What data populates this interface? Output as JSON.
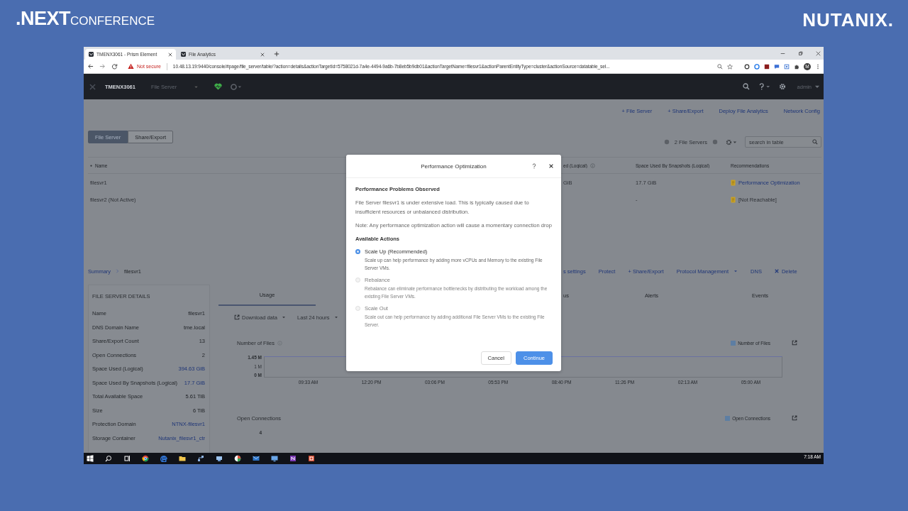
{
  "branding": {
    "event_logo": ".NEXT",
    "event_logo_suffix": "CONFERENCE",
    "sponsor_logo": "NUTANIX."
  },
  "browser": {
    "tabs": [
      {
        "title": "TMENX3061 - Prism Element",
        "selected": true
      },
      {
        "title": "File Analytics",
        "selected": false
      }
    ],
    "security_label": "Not secure",
    "url": "10.48.13.19:9440/console/#page/file_server/table/?action=details&actionTargetId=5758021d-7a4e-4494-9a6b-7b8eb5b9db01&actionTargetName=filesvr1&actionParentEntityType=cluster&actionSource=datatable_sel...",
    "profile_initial": "M"
  },
  "app_header": {
    "cluster_name": "TMENX3061",
    "section": "File Server",
    "user": "admin"
  },
  "top_actions": [
    "+ File Server",
    "+ Share/Export",
    "Deploy File Analytics",
    "Network Config"
  ],
  "view_toggle": [
    {
      "label": "File Server",
      "selected": true
    },
    {
      "label": "Share/Export",
      "selected": false
    }
  ],
  "table_summary": "2 File Servers",
  "search": {
    "placeholder": "search in table"
  },
  "table": {
    "columns": [
      "Name",
      "ed (Logical)",
      "Space Used By Snapshots (Logical)",
      "Recommendations"
    ],
    "rows": [
      {
        "name": "filesvr1",
        "column_2": "GiB",
        "snapshots": "17.7 GiB",
        "recommendation": "Performance Optimization",
        "kind": "link"
      },
      {
        "name": "filesvr2 (Not Active)",
        "snapshots": "-",
        "recommendation": "[Not Reachable]",
        "kind": "text"
      }
    ]
  },
  "breadcrumb": [
    "Summary",
    "filesvr1"
  ],
  "detail_actions": [
    {
      "label": "s settings",
      "kind": "plain"
    },
    {
      "label": "Protect",
      "kind": "plain"
    },
    {
      "label": "+ Share/Export",
      "kind": "plain"
    },
    {
      "label": "Protocol Management",
      "kind": "dropdown"
    },
    {
      "label": "DNS",
      "kind": "plain"
    },
    {
      "label": "Delete",
      "kind": "delete"
    }
  ],
  "details": {
    "title": "FILE SERVER DETAILS",
    "rows": [
      {
        "label": "Name",
        "value": "filesvr1",
        "kind": "text"
      },
      {
        "label": "DNS Domain Name",
        "value": "tme.local",
        "kind": "text"
      },
      {
        "label": "Share/Export Count",
        "value": "13",
        "kind": "text"
      },
      {
        "label": "Open Connections",
        "value": "2",
        "kind": "text"
      },
      {
        "label": "Space Used (Logical)",
        "value": "394.63 GiB",
        "kind": "link"
      },
      {
        "label": "Space Used By Snapshots (Logical)",
        "value": "17.7 GiB",
        "kind": "link"
      },
      {
        "label": "Total Available Space",
        "value": "5.61 TiB",
        "kind": "text"
      },
      {
        "label": "Size",
        "value": "6 TiB",
        "kind": "text"
      },
      {
        "label": "Protection Domain",
        "value": "NTNX-filesvr1",
        "kind": "link"
      },
      {
        "label": "Storage Container",
        "value": "Nutanix_filesvr1_ctr",
        "kind": "link"
      }
    ]
  },
  "tabs": [
    {
      "label": "Usage",
      "selected": true
    },
    {
      "label": "us",
      "selected": false
    },
    {
      "label": "Alerts",
      "selected": false
    },
    {
      "label": "Events",
      "selected": false
    }
  ],
  "usage_controls": [
    "Download data",
    "Last 24 hours"
  ],
  "charts": [
    {
      "title": "Number of Files",
      "legend": "Number of Files",
      "y_ticks": [
        "1.45 M",
        "1 M",
        "0 M"
      ],
      "x_labels": [
        "09:33 AM",
        "12:20 PM",
        "03:06 PM",
        "05:53 PM",
        "08:40 PM",
        "11:26 PM",
        "02:13 AM",
        "05:00 AM"
      ]
    },
    {
      "title": "Open Connections",
      "legend": "Open Connections",
      "y_ticks": [
        "4"
      ]
    }
  ],
  "dialog": {
    "title": "Performance Optimization",
    "section_title": "Performance Problems Observed",
    "message": "File Server filesvr1 is under extensive load. This is typically caused due to insufficient resources or unbalanced distribution.",
    "note": "Note: Any performance optimization action will cause a momentary connection drop",
    "actions_title": "Available Actions",
    "options": [
      {
        "label": "Scale Up (Recommended)",
        "description": "Scale up can help performance by adding more vCPUs and Memory to the existing File Server VMs.",
        "selected": true,
        "disabled": false
      },
      {
        "label": "Rebalance",
        "description": "Rebalance can eliminate performance bottlenecks by distributing the workload among the existing File Server VMs.",
        "selected": false,
        "disabled": true
      },
      {
        "label": "Scale Out",
        "description": "Scale out can help performance by adding additional File Server VMs to the existing File Server.",
        "selected": false,
        "disabled": true
      }
    ],
    "buttons": [
      "Cancel",
      "Continue"
    ]
  },
  "taskbar": {
    "time": "7:18 AM"
  }
}
